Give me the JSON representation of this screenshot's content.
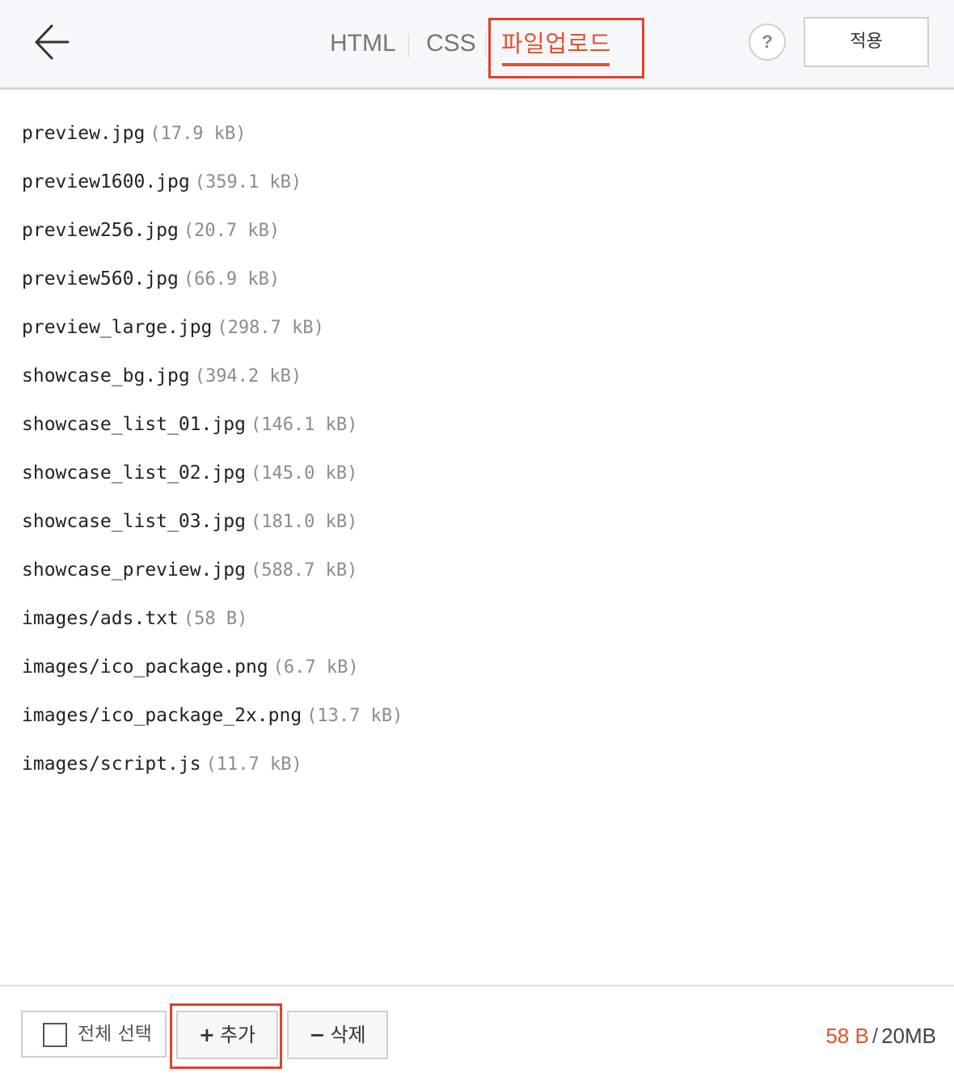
{
  "header": {
    "tabs": [
      {
        "label": "HTML",
        "active": false
      },
      {
        "label": "CSS",
        "active": false
      },
      {
        "label": "파일업로드",
        "active": true
      }
    ],
    "help_label": "?",
    "apply_label": "적용",
    "back_icon": "arrow-left-icon"
  },
  "files": [
    {
      "name": "preview.jpg",
      "size": "(17.9 kB)"
    },
    {
      "name": "preview1600.jpg",
      "size": "(359.1 kB)"
    },
    {
      "name": "preview256.jpg",
      "size": "(20.7 kB)"
    },
    {
      "name": "preview560.jpg",
      "size": "(66.9 kB)"
    },
    {
      "name": "preview_large.jpg",
      "size": "(298.7 kB)"
    },
    {
      "name": "showcase_bg.jpg",
      "size": "(394.2 kB)"
    },
    {
      "name": "showcase_list_01.jpg",
      "size": "(146.1 kB)"
    },
    {
      "name": "showcase_list_02.jpg",
      "size": "(145.0 kB)"
    },
    {
      "name": "showcase_list_03.jpg",
      "size": "(181.0 kB)"
    },
    {
      "name": "showcase_preview.jpg",
      "size": "(588.7 kB)"
    },
    {
      "name": "images/ads.txt",
      "size": "(58 B)"
    },
    {
      "name": "images/ico_package.png",
      "size": "(6.7 kB)"
    },
    {
      "name": "images/ico_package_2x.png",
      "size": "(13.7 kB)"
    },
    {
      "name": "images/script.js",
      "size": "(11.7 kB)"
    }
  ],
  "footer": {
    "select_all_label": "전체 선택",
    "add_symbol": "+",
    "add_label": "추가",
    "delete_symbol": "−",
    "delete_label": "삭제",
    "storage_used": "58 B",
    "storage_separator": "/",
    "storage_limit": "20MB"
  },
  "colors": {
    "accent": "#e0532f",
    "highlight_box": "#e2402b",
    "header_bg": "#f6f7fb"
  }
}
